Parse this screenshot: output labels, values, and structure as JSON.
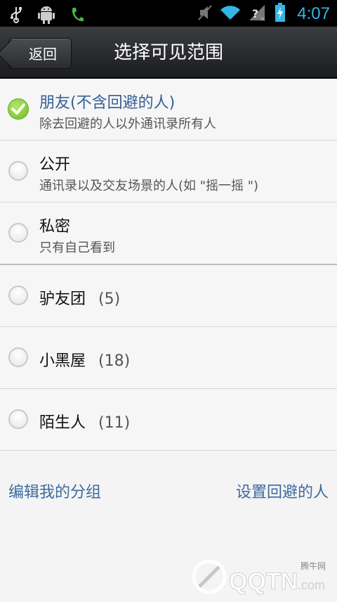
{
  "status_bar": {
    "time": "4:07",
    "icons_left": [
      "usb-icon",
      "android-debug-icon",
      "phone-icon"
    ],
    "icons_right": [
      "mute-icon",
      "wifi-icon",
      "no-signal-icon",
      "battery-charging-icon"
    ]
  },
  "title_bar": {
    "back_label": "返回",
    "title": "选择可见范围"
  },
  "options": [
    {
      "label": "朋友(不含回避的人)",
      "desc": "除去回避的人以外通讯录所有人",
      "selected": true
    },
    {
      "label": "公开",
      "desc": "通讯录以及交友场景的人(如 \"摇一摇 \")",
      "selected": false
    },
    {
      "label": "私密",
      "desc": "只有自己看到",
      "selected": false
    }
  ],
  "groups": [
    {
      "label": "驴友团",
      "count": "(5)"
    },
    {
      "label": "小黑屋",
      "count": "(18)"
    },
    {
      "label": "陌生人",
      "count": "(11)"
    }
  ],
  "footer": {
    "edit_groups": "编辑我的分组",
    "set_avoid": "设置回避的人"
  },
  "watermark": {
    "brand": "QQTN.com",
    "tag": "腾牛网"
  },
  "colors": {
    "accent_text": "#355f94",
    "link": "#3c6aa0",
    "check_green": "#6dbb1e"
  }
}
